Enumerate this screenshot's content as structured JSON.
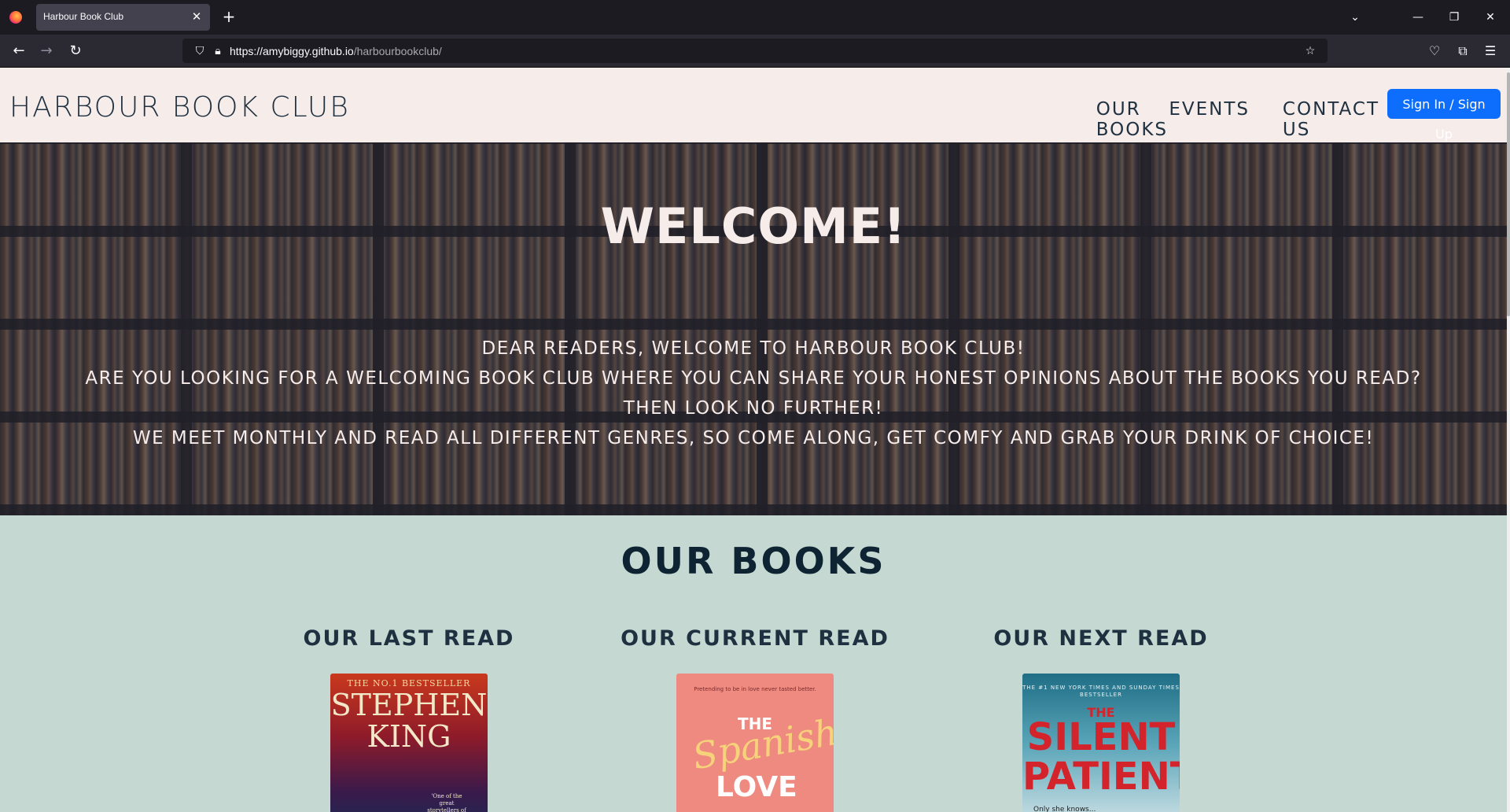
{
  "browser": {
    "tab_title": "Harbour Book Club",
    "url_host": "https://amybiggy.github.io",
    "url_path": "/harbourbookclub/",
    "icons": [
      "firefox-logo",
      "close-icon",
      "plus-icon",
      "chevron-down-icon",
      "minimize-icon",
      "restore-icon",
      "close-window-icon",
      "back-icon",
      "forward-icon",
      "reload-icon",
      "shield-icon",
      "lock-icon",
      "star-icon",
      "pocket-icon",
      "extensions-icon",
      "menu-icon"
    ]
  },
  "site": {
    "brand": "HARBOUR BOOK CLUB",
    "nav": [
      "OUR BOOKS",
      "EVENTS",
      "CONTACT US"
    ],
    "signin_label": "Sign In / Sign Up",
    "accent_color": "#0d6efd",
    "header_bg": "#f6ecea",
    "section_bg": "#c5d9d2"
  },
  "hero": {
    "title": "WELCOME!",
    "lines": [
      "DEAR READERS, WELCOME TO HARBOUR BOOK CLUB!",
      "ARE YOU LOOKING FOR A WELCOMING BOOK CLUB WHERE YOU CAN SHARE YOUR HONEST OPINIONS ABOUT THE BOOKS YOU READ?",
      "THEN LOOK NO FURTHER!",
      "WE MEET MONTHLY AND READ ALL DIFFERENT GENRES, SO COME ALONG, GET COMFY AND GRAB YOUR DRINK OF CHOICE!"
    ]
  },
  "books": {
    "title": "OUR BOOKS",
    "columns": [
      {
        "heading": "OUR LAST READ",
        "cover": {
          "line1": "THE NO.1 BESTSELLER",
          "line2": "STEPHEN KING",
          "line3": "'One of the great storytellers of our time'"
        }
      },
      {
        "heading": "OUR CURRENT READ",
        "cover": {
          "line1": "Pretending to be in love never tasted better.",
          "line2": "THE",
          "line3": "Spanish",
          "line4": "LOVE"
        }
      },
      {
        "heading": "OUR NEXT READ",
        "cover": {
          "line1": "THE #1 NEW YORK TIMES AND SUNDAY TIMES BESTSELLER",
          "line2": "THE",
          "line3": "SILENT PATIENT",
          "line4": "Only she knows..."
        }
      }
    ]
  }
}
